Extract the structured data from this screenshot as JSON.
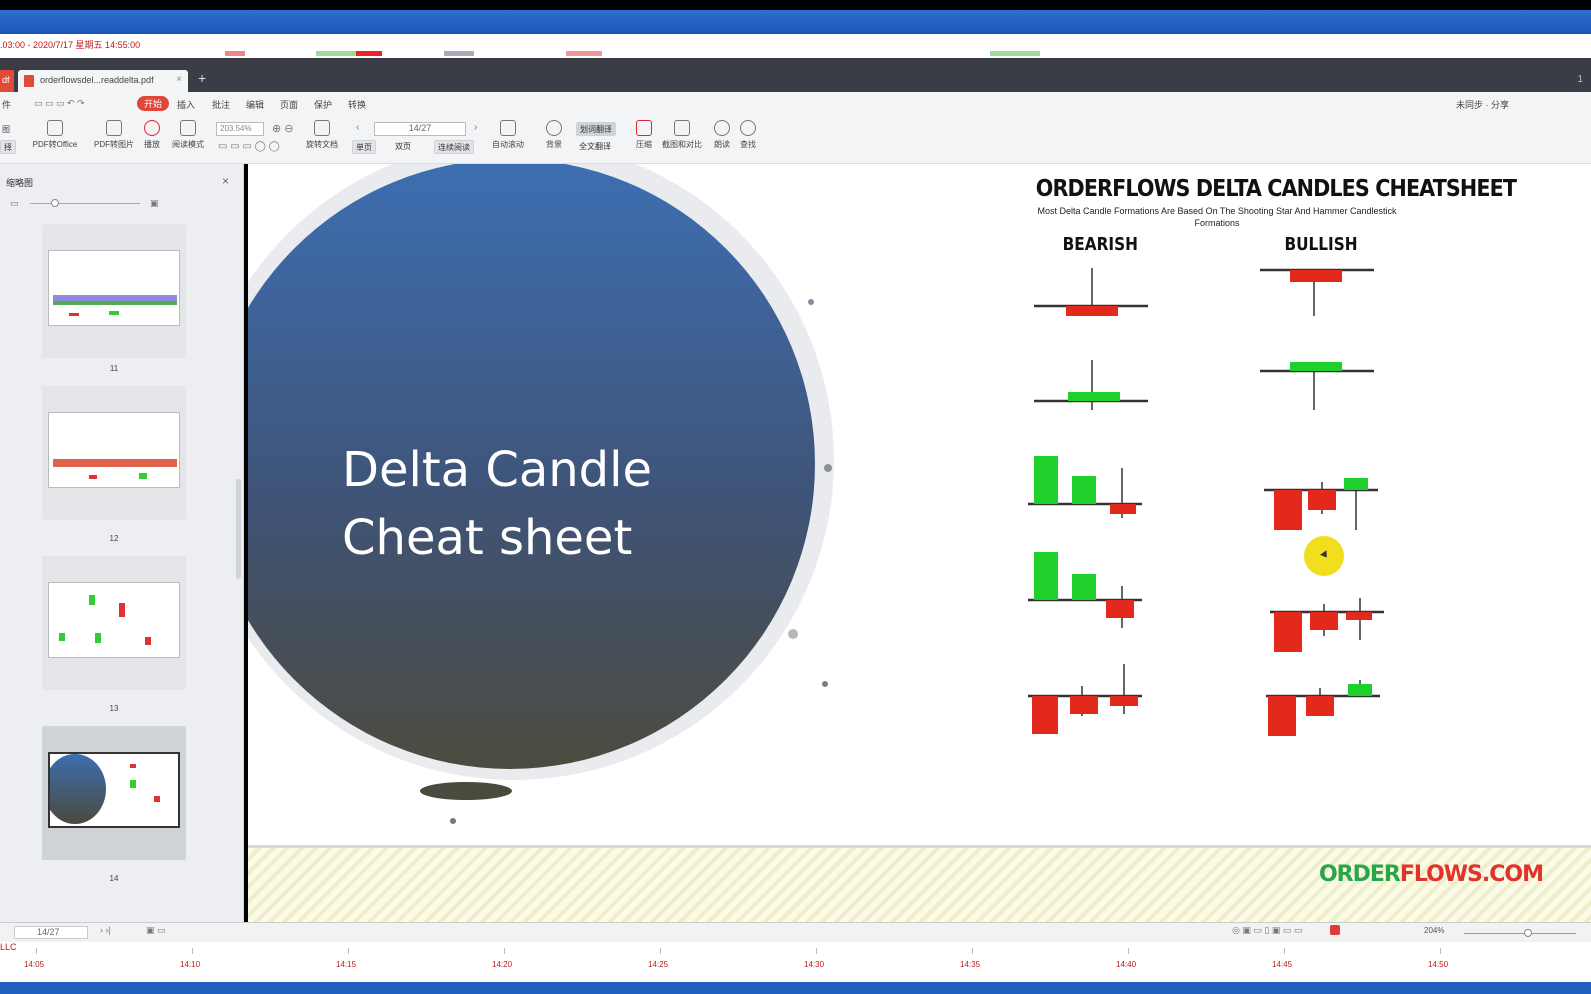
{
  "window": {
    "status_text": ".03:00 - 2020/7/17 星期五 14:55:00"
  },
  "tabs": {
    "pdf_badge": "df",
    "doc_title": "orderflowsdel...readdelta.pdf",
    "close": "×",
    "add": "+",
    "page_count_badge": "1"
  },
  "menu": {
    "items": [
      "件",
      "开始",
      "插入",
      "批注",
      "编辑",
      "页面",
      "保护",
      "转换"
    ],
    "right": "未同步 · 分享"
  },
  "toolbar": {
    "left_top": "图",
    "left_bottom": "择",
    "pdf_to_office": "PDF转Office",
    "pdf_to_image": "PDF转图片",
    "play": "播放",
    "read_mode": "阅读模式",
    "zoom_value": "203.54%",
    "rotate": "旋转文档",
    "single": "单页",
    "double": "双页",
    "continuous": "连续阅读",
    "auto_scroll": "自动滚动",
    "page_value": "14/27",
    "background": "背景",
    "translate": "划词翻译",
    "full_translate": "全文翻译",
    "compress": "压缩",
    "screenshot": "截图和对比",
    "read_aloud": "朗读",
    "find": "查找"
  },
  "sidebar": {
    "title": "缩略图",
    "close": "×",
    "thumbnails": [
      {
        "page": "11"
      },
      {
        "page": "12"
      },
      {
        "page": "13"
      },
      {
        "page": "14"
      }
    ]
  },
  "slide": {
    "title_line1": "Delta Candle",
    "title_line2": "Cheat sheet",
    "cheat_title": "ORDERFLOWS DELTA CANDLES CHEATSHEET",
    "cheat_subtitle": "Most Delta Candle Formations Are Based On The Shooting Star And Hammer Candlestick Formations",
    "bearish": "BEARISH",
    "bullish": "BULLISH",
    "brand_green": "ORDER",
    "brand_red": "FLOWS.COM",
    "colors": {
      "up": "#1fcf2c",
      "down": "#e3281c",
      "circle_top": "#3d6eb0",
      "circle_bottom": "#4a4a3e"
    }
  },
  "bottombar": {
    "page_value": "14/27",
    "zoom": "204%"
  },
  "timeaxis": {
    "label": "LLC",
    "ticks": [
      "14:05",
      "14:10",
      "14:15",
      "14:20",
      "14:25",
      "14:30",
      "14:35",
      "14:40",
      "14:45",
      "14:50"
    ]
  }
}
